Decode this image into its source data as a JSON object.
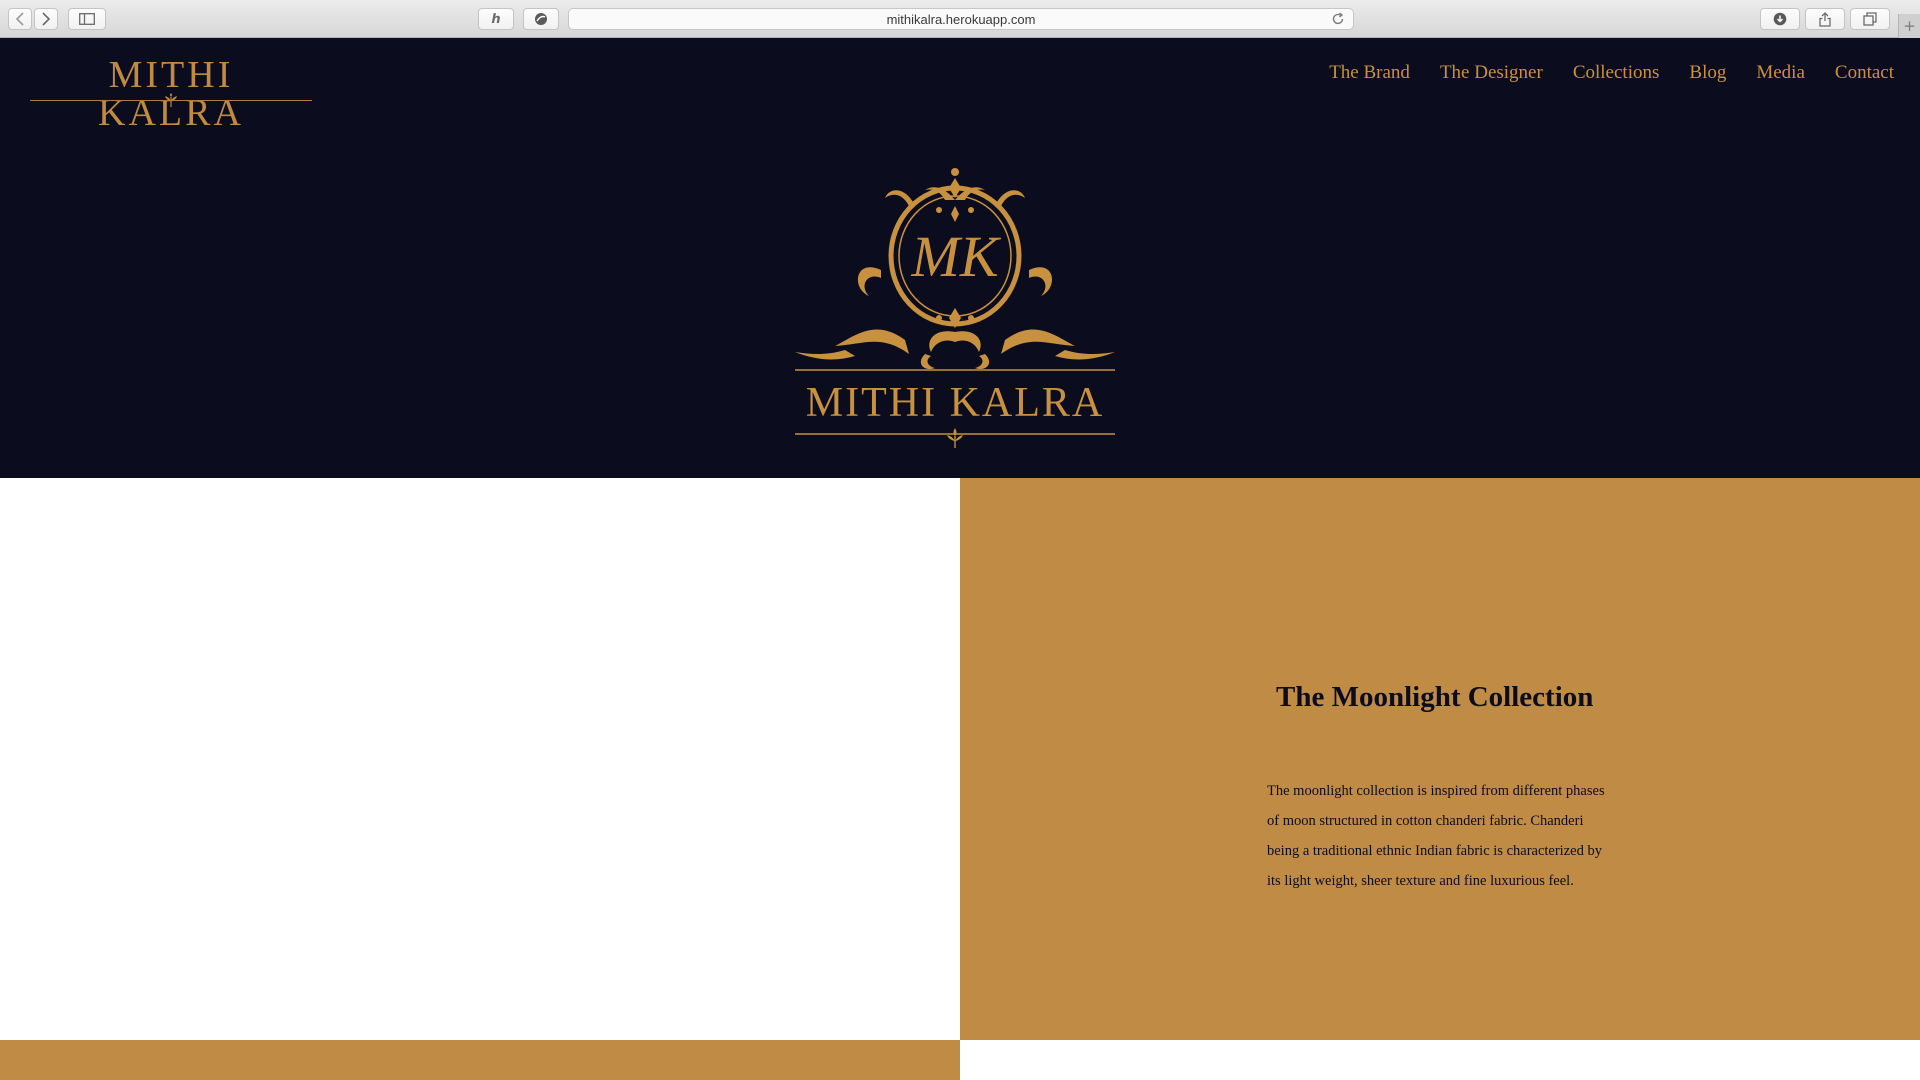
{
  "browser": {
    "url": "mithikalra.herokuapp.com",
    "icons": [
      "back-arrow-icon",
      "forward-arrow-icon",
      "sidebar-icon",
      "extension-icon",
      "privacy-icon",
      "reload-icon",
      "download-icon",
      "share-icon",
      "tabs-icon",
      "new-tab-icon"
    ]
  },
  "site": {
    "brand": "MITHI KALRA",
    "monogram": "MK",
    "nav": [
      "The Brand",
      "The Designer",
      "Collections",
      "Blog",
      "Media",
      "Contact"
    ]
  },
  "collection": {
    "title": "The Moonlight Collection",
    "description": "The moonlight collection is inspired from different phases of moon structured in cotton chanderi fabric. Chanderi being a traditional ethnic Indian fabric is characterized by its light weight, sheer texture and fine luxurious feel."
  },
  "colors": {
    "navy": "#0b0d1f",
    "gold": "#c08b45",
    "gold_text": "#c8913f",
    "white": "#ffffff"
  }
}
